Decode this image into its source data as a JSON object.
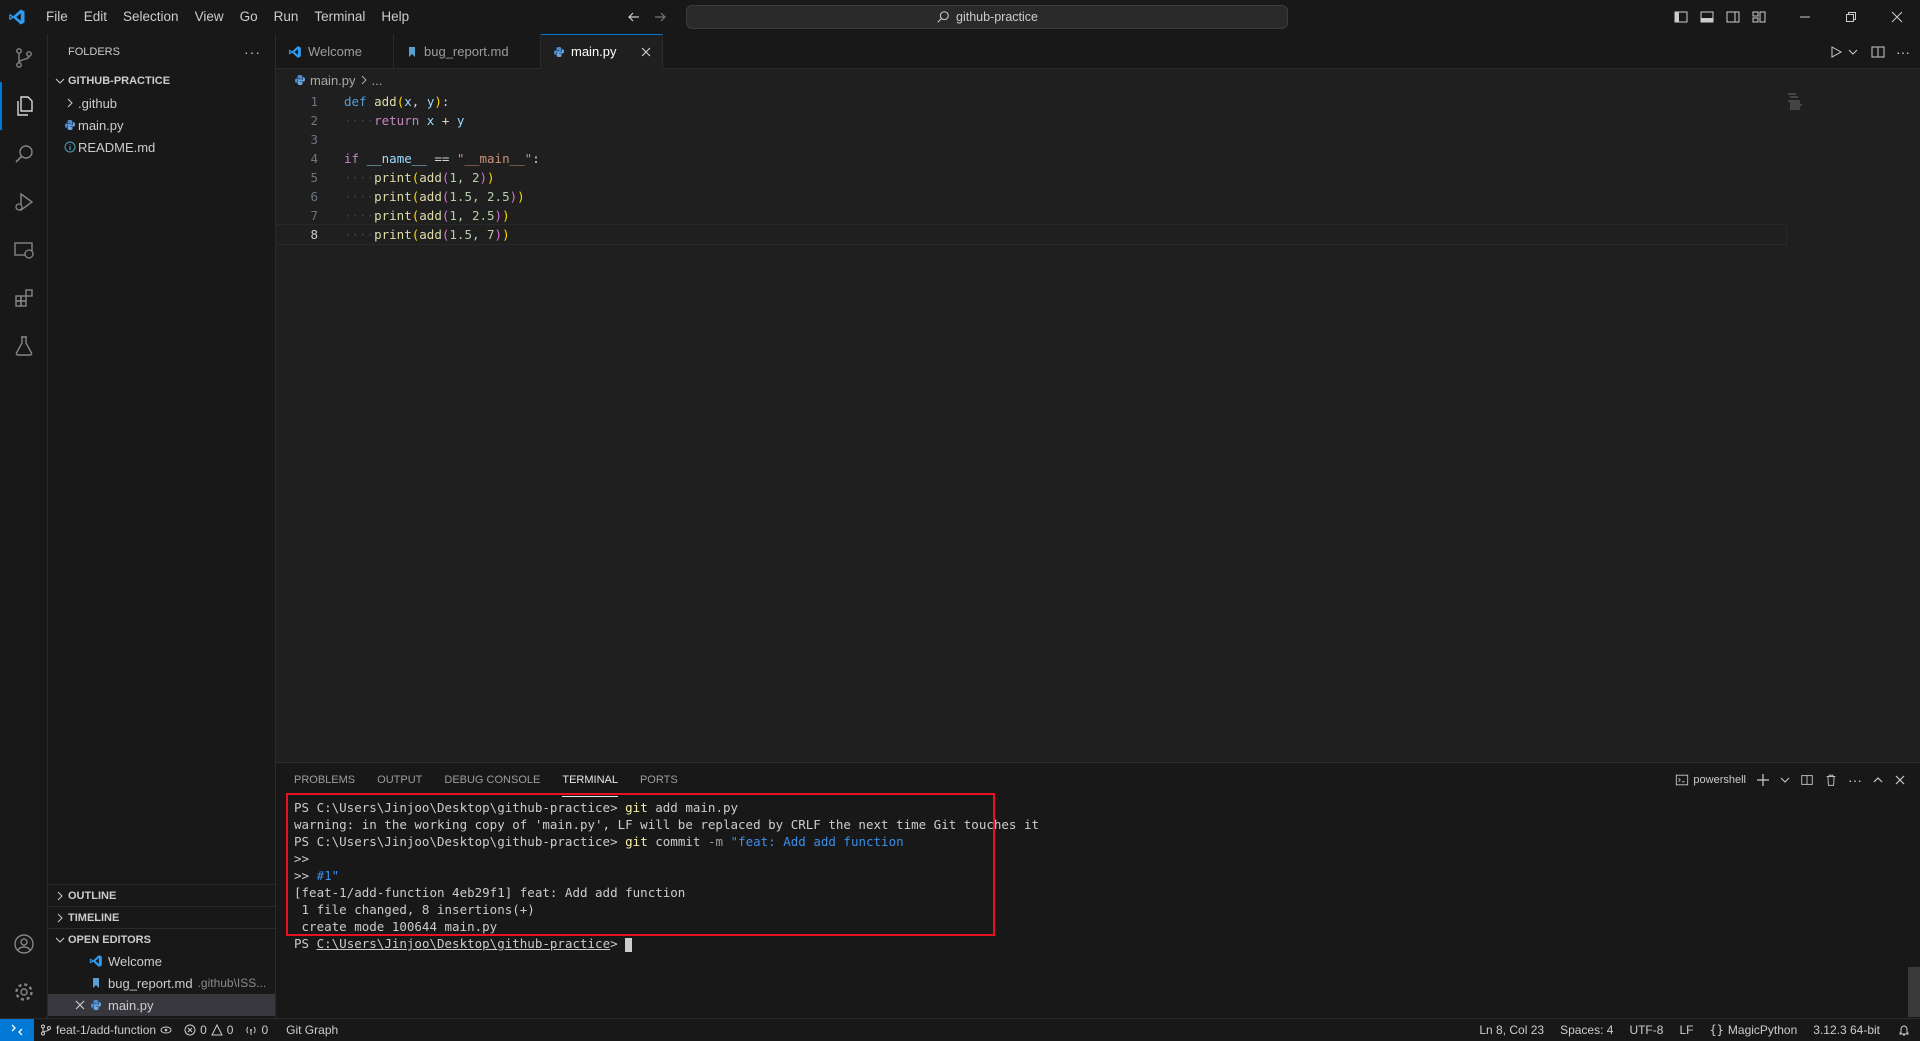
{
  "menu": [
    "File",
    "Edit",
    "Selection",
    "View",
    "Go",
    "Run",
    "Terminal",
    "Help"
  ],
  "search": {
    "text": "github-practice"
  },
  "sidebar": {
    "header": "FOLDERS",
    "project": "GITHUB-PRACTICE",
    "items": [
      {
        "label": ".github",
        "type": "folder"
      },
      {
        "label": "main.py",
        "type": "python"
      },
      {
        "label": "README.md",
        "type": "info"
      }
    ],
    "outline": "OUTLINE",
    "timeline": "TIMELINE",
    "open_editors": "OPEN EDITORS",
    "open_files": [
      {
        "label": "Welcome",
        "desc": ""
      },
      {
        "label": "bug_report.md",
        "desc": ".github\\ISS..."
      },
      {
        "label": "main.py",
        "desc": ""
      }
    ]
  },
  "tabs": [
    {
      "label": "Welcome"
    },
    {
      "label": "bug_report.md"
    },
    {
      "label": "main.py"
    }
  ],
  "breadcrumb": {
    "file": "main.py",
    "more": "..."
  },
  "code": {
    "line_numbers": [
      "1",
      "2",
      "3",
      "4",
      "5",
      "6",
      "7",
      "8"
    ],
    "l1": {
      "kw": "def",
      "fn": "add",
      "p1": "(",
      "a": "x",
      "c": ", ",
      "b": "y",
      "p2": ")",
      "colon": ":"
    },
    "l2": {
      "kw": "return",
      "a": "x",
      "op": " + ",
      "b": "y"
    },
    "l4": {
      "kw": "if",
      "name": "__name__",
      "op": " == ",
      "str": "\"__main__\"",
      "colon": ":"
    },
    "calls": [
      {
        "fn": "print",
        "inner": "add",
        "args": "1, 2"
      },
      {
        "fn": "print",
        "inner": "add",
        "args": "1.5, 2.5"
      },
      {
        "fn": "print",
        "inner": "add",
        "args": "1, 2.5"
      },
      {
        "fn": "print",
        "inner": "add",
        "args": "1.5, 7"
      }
    ]
  },
  "panel": {
    "tabs": [
      "PROBLEMS",
      "OUTPUT",
      "DEBUG CONSOLE",
      "TERMINAL",
      "PORTS"
    ],
    "shell": "powershell"
  },
  "terminal": {
    "prompt": "PS C:\\Users\\Jinjoo\\Desktop\\github-practice>",
    "cmd1": "git",
    "cmd1_args": "add main.py",
    "warning": "warning: in the working copy of 'main.py', LF will be replaced by CRLF the next time Git touches it",
    "cmd2": "git",
    "cmd2_rest": "commit",
    "cmd2_flag": "-m",
    "cmd2_msg": "\"feat: Add add function",
    "cont1": ">>",
    "cont2": ">>",
    "cont2_text": "#1\"",
    "out1": "[feat-1/add-function 4eb29f1] feat: Add add function",
    "out2": " 1 file changed, 8 insertions(+)",
    "out3": " create mode 100644 main.py",
    "prompt_ps": "PS",
    "prompt_path": "C:\\Users\\Jinjoo\\Desktop\\github-practice",
    "prompt_gt": ">"
  },
  "status": {
    "branch": "feat-1/add-function",
    "errors": "0",
    "warnings": "0",
    "ports": "0",
    "git_graph": "Git Graph",
    "position": "Ln 8, Col 23",
    "spaces": "Spaces: 4",
    "encoding": "UTF-8",
    "eol": "LF",
    "language": "MagicPython",
    "interpreter": "3.12.3 64-bit"
  },
  "colors": {
    "accent": "#0078d4",
    "highlight_box": "#e81123",
    "background": "#1f1f1f"
  }
}
